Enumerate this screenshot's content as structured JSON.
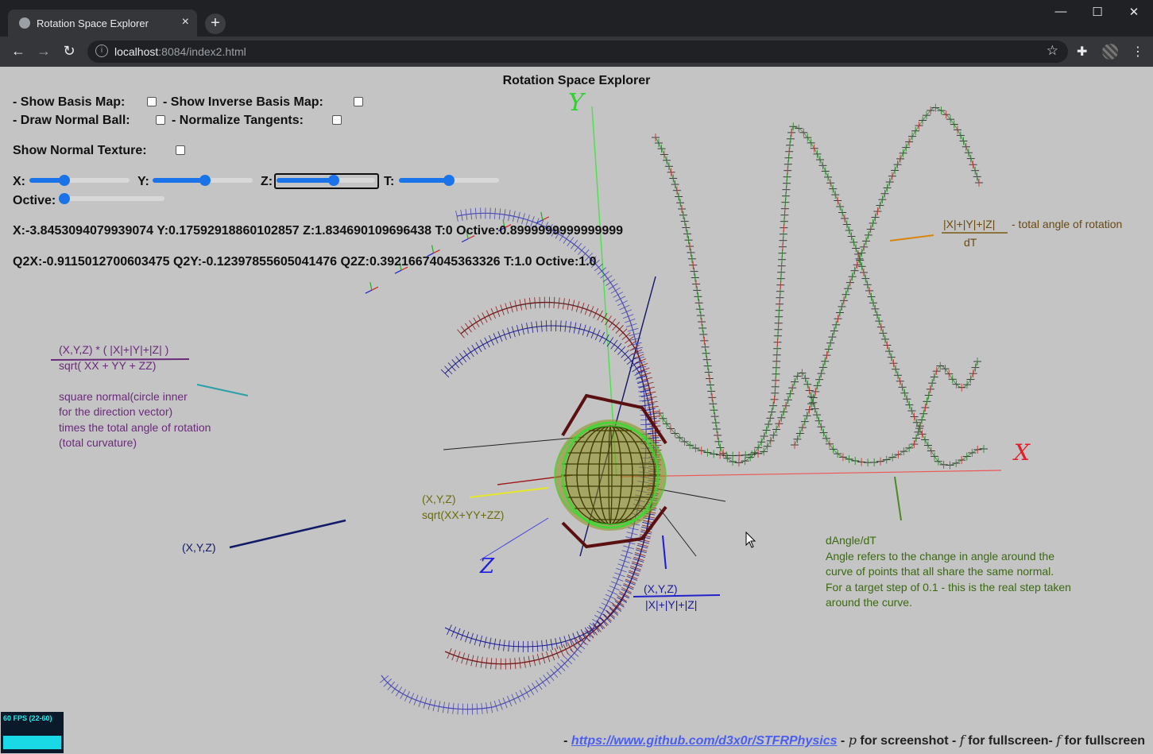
{
  "browser": {
    "tab_title": "Rotation Space Explorer",
    "new_tab": "+",
    "url_host": "localhost",
    "url_rest": ":8084/index2.html"
  },
  "page": {
    "title": "Rotation Space Explorer",
    "options": {
      "show_basis_map": "- Show Basis Map:",
      "show_inverse_basis_map": "- Show Inverse Basis Map:",
      "draw_normal_ball": "- Draw Normal Ball:",
      "normalize_tangents": "- Normalize Tangents:",
      "show_normal_texture": "Show Normal Texture:"
    },
    "sliders": {
      "x_label": "X:",
      "x_value": 0.35,
      "y_label": "Y:",
      "y_value": 0.52,
      "z_label": "Z:",
      "z_value": 0.58,
      "t_label": "T:",
      "t_value": 0.5,
      "octive_label": "Octive:",
      "octive_value": 0.0
    },
    "readout_1": "X:-3.8453094079939074 Y:0.17592918860102857 Z:1.834690109696438 T:0 Octive:0.8999999999999999",
    "readout_2": "Q2X:-0.9115012700603475 Q2Y:-0.12397855605041476 Q2Z:0.39216674045363326 T:1.0 Octive:1.0"
  },
  "annotations": {
    "axis_y": "Y",
    "axis_x": "X",
    "axis_z": "Z",
    "total_angle_num": "|X|+|Y|+|Z|",
    "total_angle_desc": "- total angle of rotation",
    "total_angle_den": "dT",
    "square_normal_num": "(X,Y,Z) * ( |X|+|Y|+|Z| )",
    "square_normal_den": "sqrt( XX + YY + ZZ)",
    "square_normal_l1": "square normal(circle inner",
    "square_normal_l2": "for the direction vector)",
    "square_normal_l3": "times the total angle of rotation",
    "square_normal_l4": "(total curvature)",
    "xyz_label": "(X,Y,Z)",
    "unit_num": "(X,Y,Z)",
    "unit_den": "sqrt(XX+YY+ZZ)",
    "l1_num": "(X,Y,Z)",
    "l1_den": "|X|+|Y|+|Z|",
    "dangle_l1": "dAngle/dT",
    "dangle_l2": "Angle refers to the change in angle around the",
    "dangle_l3": "curve of points that all share the same normal.",
    "dangle_l4": "For a target step of 0.1 - this is the real step taken",
    "dangle_l5": "around the curve."
  },
  "fps": "60 FPS (22-60)",
  "footer": {
    "lead": "- ",
    "link": "https://www.github.com/d3x0r/STFRPhysics",
    "p_sep": " - ",
    "p_key": "p",
    "p_text": " for screenshot - ",
    "f_key1": "f",
    "f_text1": " for fullscreen- ",
    "f_key2": "f",
    "f_text2": " for fullscreen"
  },
  "colors": {
    "page_bg": "#c4c4c4",
    "accent": "#1a73e8",
    "axis_x": "#e0202a",
    "axis_y": "#2fd12f",
    "axis_z": "#1a1ae0",
    "graph_mark": "#333333",
    "orange": "#c77a1a",
    "purple": "#6a2a7a",
    "navy": "#111a66",
    "olive": "#6b6b10",
    "green_note": "#3a6a10"
  }
}
